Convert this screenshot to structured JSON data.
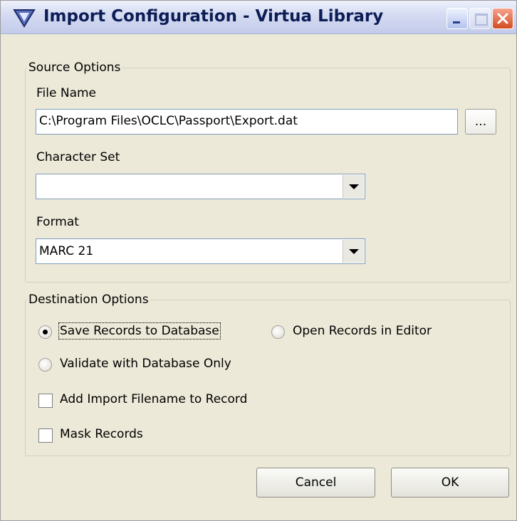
{
  "window": {
    "title": "Import Configuration - Virtua Library"
  },
  "source_options": {
    "legend": "Source Options",
    "file_name_label": "File Name",
    "file_name_value": "C:\\Program Files\\OCLC\\Passport\\Export.dat",
    "browse_label": "...",
    "character_set_label": "Character Set",
    "character_set_value": "",
    "format_label": "Format",
    "format_value": "MARC 21"
  },
  "destination_options": {
    "legend": "Destination Options",
    "save_to_database": {
      "label": "Save Records to Database",
      "checked": true
    },
    "open_in_editor": {
      "label": "Open Records in Editor",
      "checked": false
    },
    "validate_only": {
      "label": "Validate with Database Only",
      "checked": false
    },
    "add_import_filename": {
      "label": "Add Import Filename to Record",
      "checked": false
    },
    "mask_records": {
      "label": "Mask Records",
      "checked": false
    }
  },
  "buttons": {
    "cancel": "Cancel",
    "ok": "OK"
  },
  "colors": {
    "dialog_background": "#ece9d8",
    "title_text": "#0c1d56",
    "close_button": "#d24b20"
  },
  "icons": [
    "app-icon",
    "minimize-icon",
    "maximize-icon",
    "close-icon",
    "dropdown-arrow-icon"
  ]
}
